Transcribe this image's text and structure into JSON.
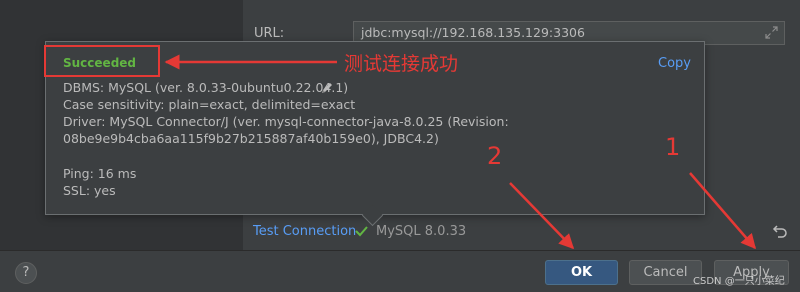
{
  "form": {
    "url_label": "URL:",
    "url_value": "jdbc:mysql://192.168.135.129:3306"
  },
  "popup": {
    "status": "Succeeded",
    "copy_label": "Copy",
    "lines": [
      "DBMS: MySQL (ver. 8.0.33-0ubuntu0.22.04.1)",
      "Case sensitivity: plain=exact, delimited=exact",
      "Driver: MySQL Connector/J (ver. mysql-connector-java-8.0.25 (Revision:",
      "08be9e9b4cba6aa115f9b27b215887af40b159e0), JDBC4.2)",
      "",
      "Ping: 16 ms",
      "SSL: yes"
    ]
  },
  "annotations": {
    "success_note": "测试连接成功",
    "marker_1": "1",
    "marker_2": "2",
    "color": "#e53935"
  },
  "test_bar": {
    "test_connection_label": "Test Connection",
    "server_version": "MySQL 8.0.33"
  },
  "footer": {
    "help_label": "?",
    "ok_label": "OK",
    "cancel_label": "Cancel",
    "apply_label": "Apply"
  },
  "watermark": "CSDN @一只小菜纪",
  "colors": {
    "success_green": "#62b543",
    "link_blue": "#589df6",
    "primary_button": "#365880"
  }
}
